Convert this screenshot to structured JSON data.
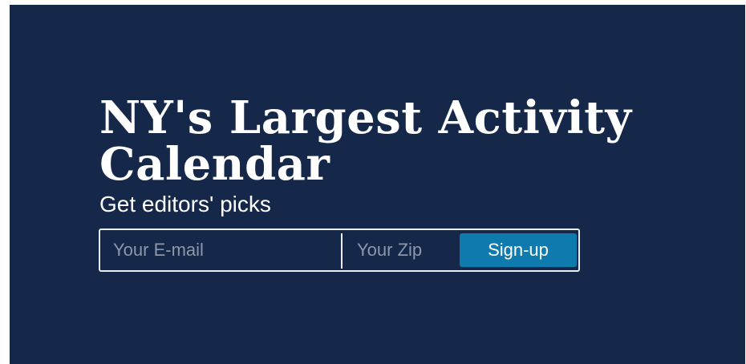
{
  "hero": {
    "title": "NY's Largest Activity Calendar",
    "subtitle": "Get editors' picks"
  },
  "signup_form": {
    "email_placeholder": "Your E-mail",
    "email_value": "",
    "zip_placeholder": "Your Zip",
    "zip_value": "",
    "submit_label": "Sign-up"
  },
  "colors": {
    "panel_background": "#15284a",
    "button_background": "#0f7aad",
    "text": "#ffffff",
    "border": "#e9ecf3"
  }
}
